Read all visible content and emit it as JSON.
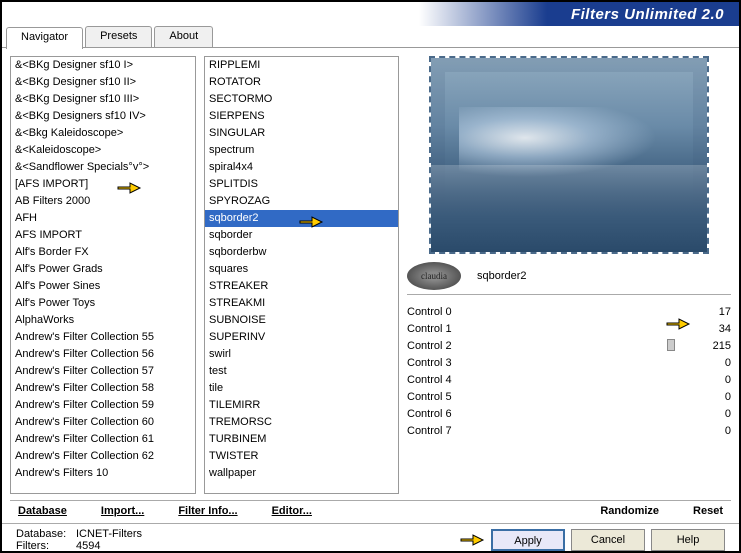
{
  "header": {
    "title": "Filters Unlimited 2.0"
  },
  "tabs": [
    "Navigator",
    "Presets",
    "About"
  ],
  "active_tab": 0,
  "categories": [
    "&<BKg Designer sf10 I>",
    "&<BKg Designer sf10 II>",
    "&<BKg Designer sf10 III>",
    "&<BKg Designers sf10 IV>",
    "&<Bkg Kaleidoscope>",
    "&<Kaleidoscope>",
    "&<Sandflower Specials°v°>",
    "[AFS IMPORT]",
    "AB Filters 2000",
    "AFH",
    "AFS IMPORT",
    "Alf's Border FX",
    "Alf's Power Grads",
    "Alf's Power Sines",
    "Alf's Power Toys",
    "AlphaWorks",
    "Andrew's Filter Collection 55",
    "Andrew's Filter Collection 56",
    "Andrew's Filter Collection 57",
    "Andrew's Filter Collection 58",
    "Andrew's Filter Collection 59",
    "Andrew's Filter Collection 60",
    "Andrew's Filter Collection 61",
    "Andrew's Filter Collection 62",
    "Andrew's Filters 10"
  ],
  "filters": [
    "RIPPLEMI",
    "ROTATOR",
    "SECTORMO",
    "SIERPENS",
    "SINGULAR",
    "spectrum",
    "spiral4x4",
    "SPLITDIS",
    "SPYROZAG",
    "sqborder2",
    "sqborder",
    "sqborderbw",
    "squares",
    "STREAKER",
    "STREAKMI",
    "SUBNOISE",
    "SUPERINV",
    "swirl",
    "test",
    "tile",
    "TILEMIRR",
    "TREMORSC",
    "TURBINEM",
    "TWISTER",
    "wallpaper"
  ],
  "selected_filter_index": 9,
  "preview": {
    "filter_name": "sqborder2",
    "logo_text": "claudia"
  },
  "controls": [
    {
      "label": "Control 0",
      "value": 17
    },
    {
      "label": "Control 1",
      "value": 34
    },
    {
      "label": "Control 2",
      "value": 215
    },
    {
      "label": "Control 3",
      "value": 0
    },
    {
      "label": "Control 4",
      "value": 0
    },
    {
      "label": "Control 5",
      "value": 0
    },
    {
      "label": "Control 6",
      "value": 0
    },
    {
      "label": "Control 7",
      "value": 0
    }
  ],
  "bottom_links": {
    "database": "Database",
    "import": "Import...",
    "filter_info": "Filter Info...",
    "editor": "Editor...",
    "randomize": "Randomize",
    "reset": "Reset"
  },
  "status": {
    "database_label": "Database:",
    "database_value": "ICNET-Filters",
    "filters_label": "Filters:",
    "filters_value": "4594"
  },
  "buttons": {
    "apply": "Apply",
    "cancel": "Cancel",
    "help": "Help"
  }
}
